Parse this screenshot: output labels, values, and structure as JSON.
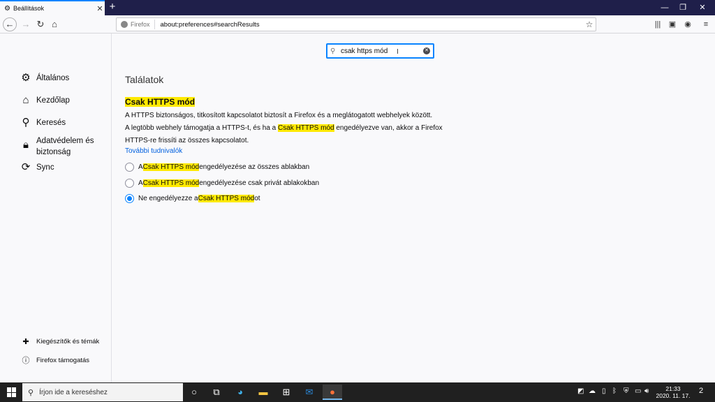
{
  "browser": {
    "tab_title": "Beállítások",
    "url_identity": "Firefox",
    "url": "about:preferences#searchResults"
  },
  "sidebar": {
    "categories": [
      {
        "label": "Általános",
        "icon": "gear-icon"
      },
      {
        "label": "Kezdőlap",
        "icon": "home-icon"
      },
      {
        "label": "Keresés",
        "icon": "search-icon"
      },
      {
        "label": "Adatvédelem és biztonság",
        "icon": "lock-icon"
      },
      {
        "label": "Sync",
        "icon": "sync-icon"
      }
    ],
    "footer": [
      {
        "label": "Kiegészítők és témák",
        "icon": "puzzle-icon"
      },
      {
        "label": "Firefox támogatás",
        "icon": "help-icon"
      }
    ]
  },
  "search": {
    "value": "csak https mód"
  },
  "main": {
    "results_title": "Találatok",
    "section_title": "Csak HTTPS mód",
    "desc_line1": "A HTTPS biztonságos, titkosított kapcsolatot biztosít a Firefox és a meglátogatott webhelyek között.",
    "desc_line2_pre": "A legtöbb webhely támogatja a HTTPS-t, és ha a ",
    "desc_line2_hl": "Csak HTTPS mód",
    "desc_line2_post": " engedélyezve van, akkor a Firefox",
    "desc_line3": "HTTPS-re frissíti az összes kapcsolatot.",
    "learn_more": "További tudnivalók",
    "options": [
      {
        "pre": "A ",
        "hl": "Csak HTTPS mód",
        "post": " engedélyezése az összes ablakban",
        "checked": false
      },
      {
        "pre": "A ",
        "hl": "Csak HTTPS mód",
        "post": " engedélyezése csak privát ablakokban",
        "checked": false
      },
      {
        "pre": "Ne engedélyezze a ",
        "hl": "Csak HTTPS mód",
        "post": "ot",
        "checked": true
      }
    ]
  },
  "taskbar": {
    "search_placeholder": "Írjon ide a kereséshez",
    "time": "21:33",
    "date": "2020. 11. 17.",
    "notification_count": "2"
  },
  "colors": {
    "accent": "#0a84ff",
    "highlight": "#ffe900",
    "link": "#0060df"
  }
}
